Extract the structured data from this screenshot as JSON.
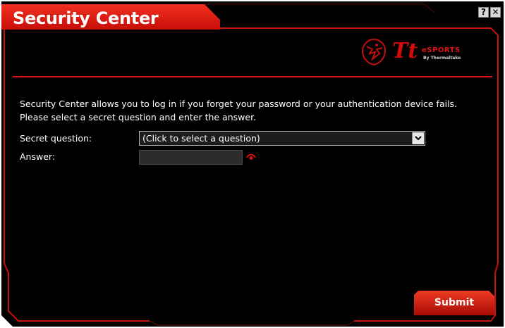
{
  "window": {
    "title": "Security Center",
    "help_label": "?",
    "close_label": "✕"
  },
  "logo": {
    "mark": "Tt",
    "brand": "eSPORTS",
    "byline": "By Thermaltake"
  },
  "description": {
    "line1": "Security Center allows you to log in if you forget your password or your authentication device fails.",
    "line2": "Please select a secret question and enter the answer."
  },
  "form": {
    "secret_question_label": "Secret question:",
    "secret_question_value": "(Click to select a question)",
    "answer_label": "Answer:",
    "answer_value": ""
  },
  "submit_label": "Submit",
  "colors": {
    "background": "#000000",
    "accent_red": "#e0140f",
    "text": "#ffffff"
  },
  "icons": [
    "help-icon",
    "close-icon",
    "dragon-logo-icon",
    "chevron-down-icon",
    "eye-icon"
  ]
}
